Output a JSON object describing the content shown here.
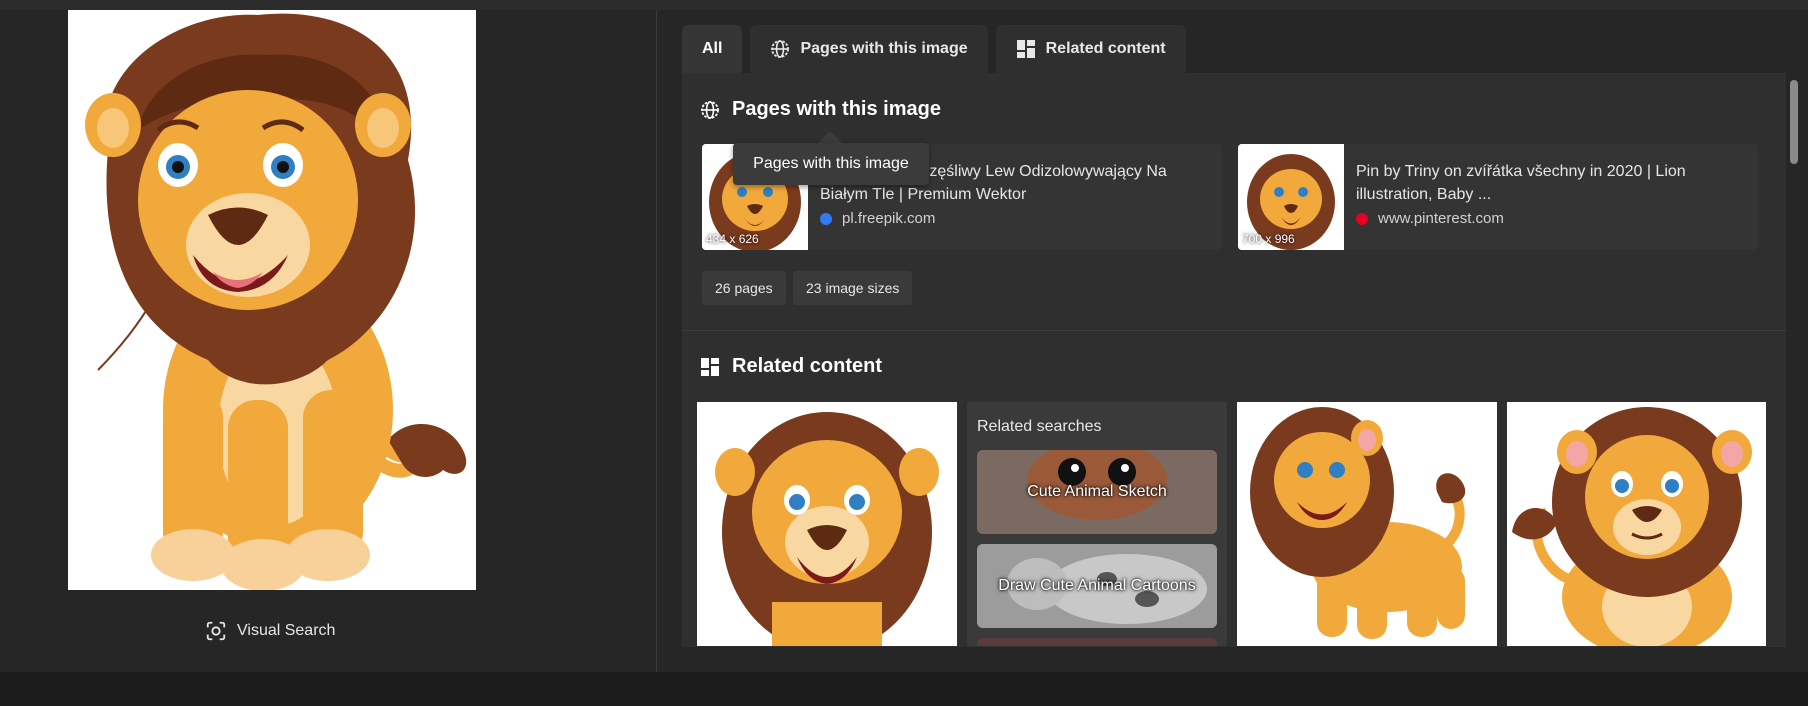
{
  "left_panel": {
    "visual_search_label": "Visual Search",
    "main_image_icon": "lion-cartoon-image"
  },
  "tabs": [
    {
      "label": "All",
      "icon": ""
    },
    {
      "label": "Pages with this image",
      "icon": "globe-icon"
    },
    {
      "label": "Related content",
      "icon": "grid-icon"
    }
  ],
  "pages_section": {
    "title": "Pages with this image",
    "tooltip": "Pages with this image",
    "results": [
      {
        "title": "Kreskówka Szczęśliwy Lew Odizolowywający Na Białym Tle | Premium Wektor",
        "source": "pl.freepik.com",
        "size": "434 x 626",
        "favicon_color": "#2f7cf6"
      },
      {
        "title": "Pin by Triny on zvířátka všechny in 2020 | Lion illustration, Baby ...",
        "source": "www.pinterest.com",
        "size": "700 x 996",
        "favicon_color": "#e60023"
      }
    ],
    "chips": [
      "26 pages",
      "23 image sizes"
    ]
  },
  "related_section": {
    "title": "Related content",
    "related_searches_title": "Related searches",
    "related_searches": [
      "Cute Animal Sketch",
      "Draw Cute Animal Cartoons"
    ]
  }
}
